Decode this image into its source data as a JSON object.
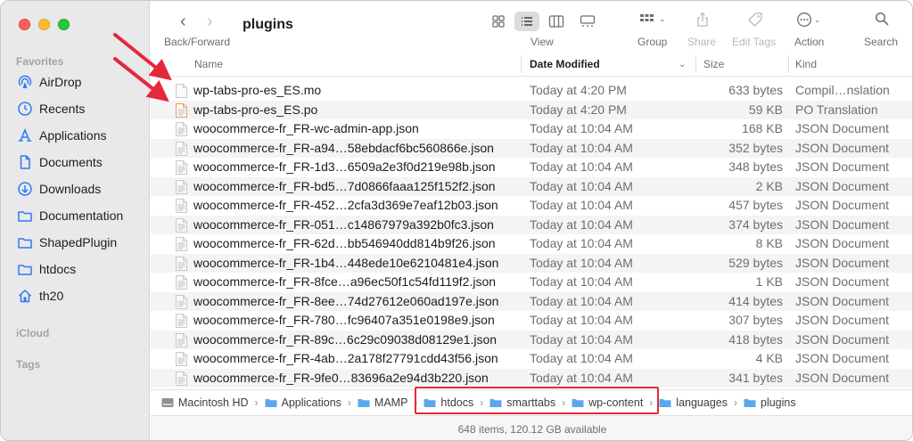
{
  "window": {
    "title": "plugins"
  },
  "sidebar": {
    "sections": {
      "favorites": "Favorites",
      "icloud": "iCloud",
      "tags": "Tags"
    },
    "items": [
      {
        "label": "AirDrop",
        "icon": "airdrop-icon"
      },
      {
        "label": "Recents",
        "icon": "clock-icon"
      },
      {
        "label": "Applications",
        "icon": "applications-icon"
      },
      {
        "label": "Documents",
        "icon": "document-icon"
      },
      {
        "label": "Downloads",
        "icon": "download-icon"
      },
      {
        "label": "Documentation",
        "icon": "folder-icon"
      },
      {
        "label": "ShapedPlugin",
        "icon": "folder-icon"
      },
      {
        "label": "htdocs",
        "icon": "folder-icon"
      },
      {
        "label": "th20",
        "icon": "home-icon"
      }
    ]
  },
  "toolbar": {
    "back_forward_label": "Back/Forward",
    "view_label": "View",
    "group_label": "Group",
    "share_label": "Share",
    "edit_tags_label": "Edit Tags",
    "action_label": "Action",
    "search_label": "Search"
  },
  "columns": {
    "name": "Name",
    "date": "Date Modified",
    "size": "Size",
    "kind": "Kind"
  },
  "files": [
    {
      "name": "wp-tabs-pro-es_ES.mo",
      "date": "Today at 4:20 PM",
      "size": "633 bytes",
      "kind": "Compil…nslation"
    },
    {
      "name": "wp-tabs-pro-es_ES.po",
      "date": "Today at 4:20 PM",
      "size": "59 KB",
      "kind": "PO Translation"
    },
    {
      "name": "woocommerce-fr_FR-wc-admin-app.json",
      "date": "Today at 10:04 AM",
      "size": "168 KB",
      "kind": "JSON Document"
    },
    {
      "name": "woocommerce-fr_FR-a94…58ebdacf6bc560866e.json",
      "date": "Today at 10:04 AM",
      "size": "352 bytes",
      "kind": "JSON Document"
    },
    {
      "name": "woocommerce-fr_FR-1d3…6509a2e3f0d219e98b.json",
      "date": "Today at 10:04 AM",
      "size": "348 bytes",
      "kind": "JSON Document"
    },
    {
      "name": "woocommerce-fr_FR-bd5…7d0866faaa125f152f2.json",
      "date": "Today at 10:04 AM",
      "size": "2 KB",
      "kind": "JSON Document"
    },
    {
      "name": "woocommerce-fr_FR-452…2cfa3d369e7eaf12b03.json",
      "date": "Today at 10:04 AM",
      "size": "457 bytes",
      "kind": "JSON Document"
    },
    {
      "name": "woocommerce-fr_FR-051…c14867979a392b0fc3.json",
      "date": "Today at 10:04 AM",
      "size": "374 bytes",
      "kind": "JSON Document"
    },
    {
      "name": "woocommerce-fr_FR-62d…bb546940dd814b9f26.json",
      "date": "Today at 10:04 AM",
      "size": "8 KB",
      "kind": "JSON Document"
    },
    {
      "name": "woocommerce-fr_FR-1b4…448ede10e6210481e4.json",
      "date": "Today at 10:04 AM",
      "size": "529 bytes",
      "kind": "JSON Document"
    },
    {
      "name": "woocommerce-fr_FR-8fce…a96ec50f1c54fd119f2.json",
      "date": "Today at 10:04 AM",
      "size": "1 KB",
      "kind": "JSON Document"
    },
    {
      "name": "woocommerce-fr_FR-8ee…74d27612e060ad197e.json",
      "date": "Today at 10:04 AM",
      "size": "414 bytes",
      "kind": "JSON Document"
    },
    {
      "name": "woocommerce-fr_FR-780…fc96407a351e0198e9.json",
      "date": "Today at 10:04 AM",
      "size": "307 bytes",
      "kind": "JSON Document"
    },
    {
      "name": "woocommerce-fr_FR-89c…6c29c09038d08129e1.json",
      "date": "Today at 10:04 AM",
      "size": "418 bytes",
      "kind": "JSON Document"
    },
    {
      "name": "woocommerce-fr_FR-4ab…2a178f27791cdd43f56.json",
      "date": "Today at 10:04 AM",
      "size": "4 KB",
      "kind": "JSON Document"
    },
    {
      "name": "woocommerce-fr_FR-9fe0…83696a2e94d3b220.json",
      "date": "Today at 10:04 AM",
      "size": "341 bytes",
      "kind": "JSON Document"
    }
  ],
  "pathbar": [
    {
      "label": "Macintosh HD",
      "icon": "hard-drive-icon"
    },
    {
      "label": "Applications",
      "icon": "folder-icon"
    },
    {
      "label": "MAMP",
      "icon": "folder-icon"
    },
    {
      "label": "htdocs",
      "icon": "folder-icon"
    },
    {
      "label": "smarttabs",
      "icon": "folder-icon"
    },
    {
      "label": "wp-content",
      "icon": "folder-icon"
    },
    {
      "label": "languages",
      "icon": "folder-icon"
    },
    {
      "label": "plugins",
      "icon": "folder-icon"
    }
  ],
  "status": {
    "text": "648 items, 120.12 GB available"
  },
  "colors": {
    "accent": "#2f7bf5",
    "annotation": "#e5283c",
    "folder": "#5aa7ef"
  }
}
